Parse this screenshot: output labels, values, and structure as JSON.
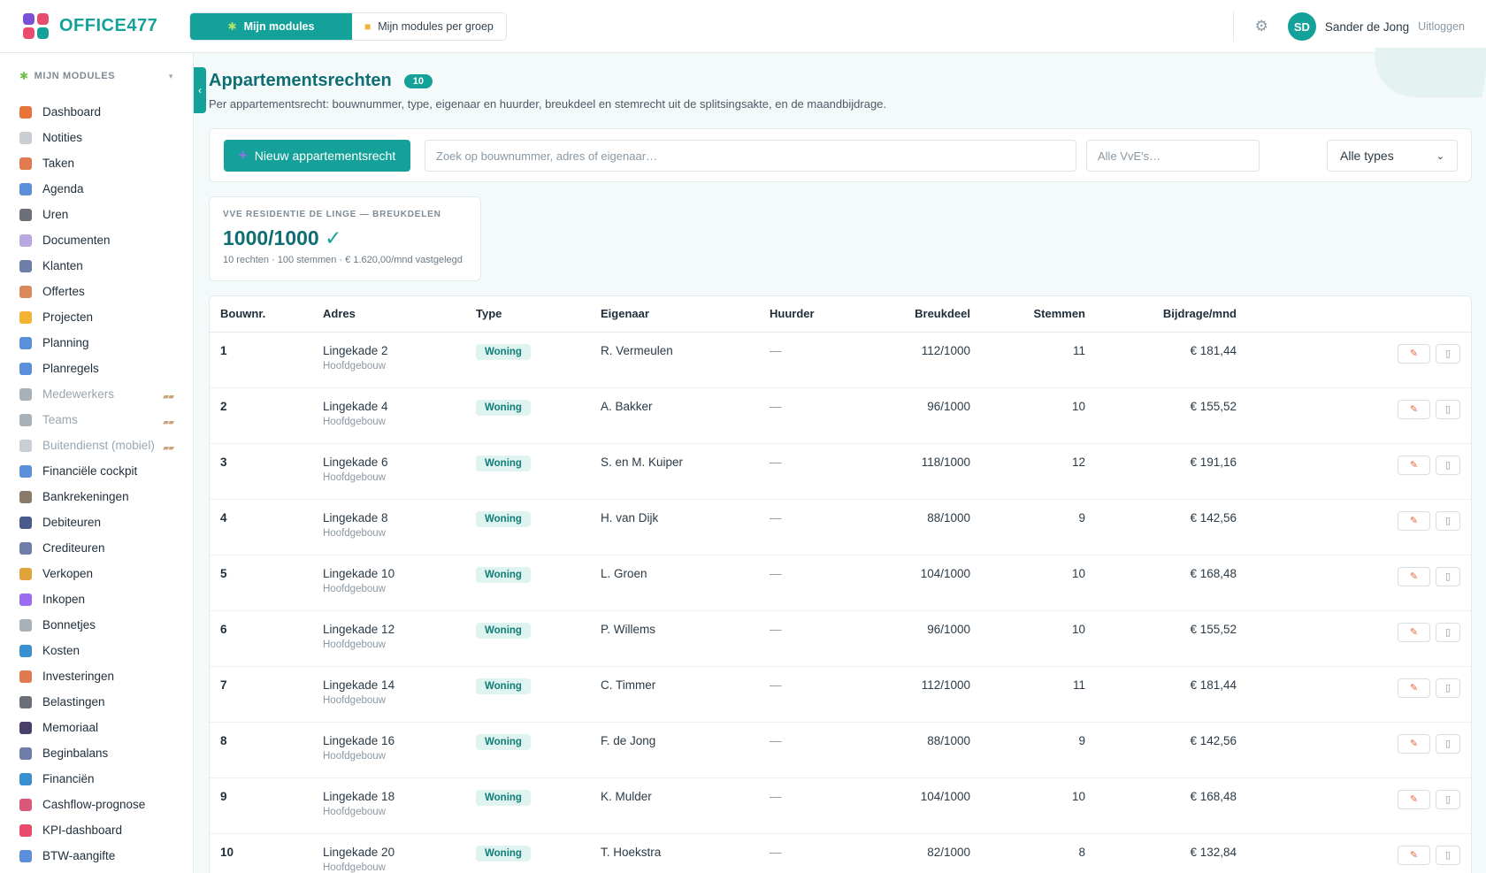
{
  "header": {
    "brand": "OFFICE477",
    "brand_colors": [
      "#7b4fd6",
      "#e84b6c",
      "#f2b233",
      "#13a19a"
    ],
    "tabs": [
      {
        "label": "Mijn modules",
        "icon": "puzzle-icon",
        "active": true
      },
      {
        "label": "Mijn modules per groep",
        "icon": "folder-icon",
        "active": false
      }
    ],
    "avatar_initials": "SD",
    "user_name": "Sander de Jong",
    "logout_label": "Uitloggen"
  },
  "sidebar": {
    "heading": "MIJN MODULES",
    "items": [
      {
        "label": "Dashboard",
        "icon": "house-icon",
        "color": "#e8743b",
        "locked": false
      },
      {
        "label": "Notities",
        "icon": "note-icon",
        "color": "#c9ced4",
        "locked": false
      },
      {
        "label": "Taken",
        "icon": "clipboard-icon",
        "color": "#e07a4f",
        "locked": false
      },
      {
        "label": "Agenda",
        "icon": "calendar-icon",
        "color": "#5b8fd9",
        "locked": false
      },
      {
        "label": "Uren",
        "icon": "clock-icon",
        "color": "#6b6f78",
        "locked": false
      },
      {
        "label": "Documenten",
        "icon": "document-icon",
        "color": "#b9a7e0",
        "locked": false
      },
      {
        "label": "Klanten",
        "icon": "building-icon",
        "color": "#6f7ea8",
        "locked": false
      },
      {
        "label": "Offertes",
        "icon": "quote-icon",
        "color": "#d9895a",
        "locked": false
      },
      {
        "label": "Projecten",
        "icon": "folder-icon",
        "color": "#f2b233",
        "locked": false
      },
      {
        "label": "Planning",
        "icon": "calendar-grid-icon",
        "color": "#5b8fd9",
        "locked": false
      },
      {
        "label": "Planregels",
        "icon": "calendar-rules-icon",
        "color": "#5b8fd9",
        "locked": false
      },
      {
        "label": "Medewerkers",
        "icon": "user-icon",
        "color": "#a8b0b8",
        "locked": true
      },
      {
        "label": "Teams",
        "icon": "users-icon",
        "color": "#a8b0b8",
        "locked": true
      },
      {
        "label": "Buitendienst (mobiel)",
        "icon": "mobile-icon",
        "color": "#c9ced4",
        "locked": true
      },
      {
        "label": "Financiële cockpit",
        "icon": "cockpit-icon",
        "color": "#5b8fd9",
        "locked": false
      },
      {
        "label": "Bankrekeningen",
        "icon": "bank-icon",
        "color": "#8a7a6a",
        "locked": false
      },
      {
        "label": "Debiteuren",
        "icon": "debtors-icon",
        "color": "#4a5a8a",
        "locked": false
      },
      {
        "label": "Crediteuren",
        "icon": "creditors-icon",
        "color": "#6f7ea8",
        "locked": false
      },
      {
        "label": "Verkopen",
        "icon": "moneybag-icon",
        "color": "#e0a23a",
        "locked": false
      },
      {
        "label": "Inkopen",
        "icon": "inbox-icon",
        "color": "#9a6cf0",
        "locked": false
      },
      {
        "label": "Bonnetjes",
        "icon": "receipt-icon",
        "color": "#a8b0b8",
        "locked": false
      },
      {
        "label": "Kosten",
        "icon": "cost-icon",
        "color": "#3a8fd0",
        "locked": false
      },
      {
        "label": "Investeringen",
        "icon": "investment-icon",
        "color": "#e07a4f",
        "locked": false
      },
      {
        "label": "Belastingen",
        "icon": "tax-building-icon",
        "color": "#6b6f78",
        "locked": false
      },
      {
        "label": "Memoriaal",
        "icon": "book-icon",
        "color": "#4a3f6a",
        "locked": false
      },
      {
        "label": "Beginbalans",
        "icon": "balance-icon",
        "color": "#6f7ea8",
        "locked": false
      },
      {
        "label": "Financiën",
        "icon": "finance-icon",
        "color": "#3a8fd0",
        "locked": false
      },
      {
        "label": "Cashflow-prognose",
        "icon": "chart-icon",
        "color": "#d9587a",
        "locked": false
      },
      {
        "label": "KPI-dashboard",
        "icon": "target-icon",
        "color": "#e84b6c",
        "locked": false
      },
      {
        "label": "BTW-aangifte",
        "icon": "vat-icon",
        "color": "#5b8fd9",
        "locked": false
      }
    ]
  },
  "page": {
    "title": "Appartementsrechten",
    "count": "10",
    "subtitle": "Per appartementsrecht: bouwnummer, type, eigenaar en huurder, breukdeel en stemrecht uit de splitsingsakte, en de maandbijdrage."
  },
  "toolbar": {
    "new_button": "Nieuw appartementsrecht",
    "search_placeholder": "Zoek op bouwnummer, adres of eigenaar…",
    "vve_placeholder": "Alle VvE's…",
    "type_select": "Alle types"
  },
  "stat": {
    "label": "VVE RESIDENTIE DE LINGE — BREUKDELEN",
    "value": "1000/1000",
    "check": "✓",
    "meta": "10 rechten · 100 stemmen · € 1.620,00/mnd vastgelegd"
  },
  "table": {
    "columns": [
      "Bouwnr.",
      "Adres",
      "Type",
      "Eigenaar",
      "Huurder",
      "Breukdeel",
      "Stemmen",
      "Bijdrage/mnd"
    ],
    "rows": [
      {
        "bouwnr": "1",
        "adres": "Lingekade 2",
        "sub": "Hoofdgebouw",
        "type": "Woning",
        "eigenaar": "R. Vermeulen",
        "huurder": "—",
        "breukdeel": "112/1000",
        "stemmen": "11",
        "bijdrage": "€ 181,44"
      },
      {
        "bouwnr": "2",
        "adres": "Lingekade 4",
        "sub": "Hoofdgebouw",
        "type": "Woning",
        "eigenaar": "A. Bakker",
        "huurder": "—",
        "breukdeel": "96/1000",
        "stemmen": "10",
        "bijdrage": "€ 155,52"
      },
      {
        "bouwnr": "3",
        "adres": "Lingekade 6",
        "sub": "Hoofdgebouw",
        "type": "Woning",
        "eigenaar": "S. en M. Kuiper",
        "huurder": "—",
        "breukdeel": "118/1000",
        "stemmen": "12",
        "bijdrage": "€ 191,16"
      },
      {
        "bouwnr": "4",
        "adres": "Lingekade 8",
        "sub": "Hoofdgebouw",
        "type": "Woning",
        "eigenaar": "H. van Dijk",
        "huurder": "—",
        "breukdeel": "88/1000",
        "stemmen": "9",
        "bijdrage": "€ 142,56"
      },
      {
        "bouwnr": "5",
        "adres": "Lingekade 10",
        "sub": "Hoofdgebouw",
        "type": "Woning",
        "eigenaar": "L. Groen",
        "huurder": "—",
        "breukdeel": "104/1000",
        "stemmen": "10",
        "bijdrage": "€ 168,48"
      },
      {
        "bouwnr": "6",
        "adres": "Lingekade 12",
        "sub": "Hoofdgebouw",
        "type": "Woning",
        "eigenaar": "P. Willems",
        "huurder": "—",
        "breukdeel": "96/1000",
        "stemmen": "10",
        "bijdrage": "€ 155,52"
      },
      {
        "bouwnr": "7",
        "adres": "Lingekade 14",
        "sub": "Hoofdgebouw",
        "type": "Woning",
        "eigenaar": "C. Timmer",
        "huurder": "—",
        "breukdeel": "112/1000",
        "stemmen": "11",
        "bijdrage": "€ 181,44"
      },
      {
        "bouwnr": "8",
        "adres": "Lingekade 16",
        "sub": "Hoofdgebouw",
        "type": "Woning",
        "eigenaar": "F. de Jong",
        "huurder": "—",
        "breukdeel": "88/1000",
        "stemmen": "9",
        "bijdrage": "€ 142,56"
      },
      {
        "bouwnr": "9",
        "adres": "Lingekade 18",
        "sub": "Hoofdgebouw",
        "type": "Woning",
        "eigenaar": "K. Mulder",
        "huurder": "—",
        "breukdeel": "104/1000",
        "stemmen": "10",
        "bijdrage": "€ 168,48"
      },
      {
        "bouwnr": "10",
        "adres": "Lingekade 20",
        "sub": "Hoofdgebouw",
        "type": "Woning",
        "eigenaar": "T. Hoekstra",
        "huurder": "—",
        "breukdeel": "82/1000",
        "stemmen": "8",
        "bijdrage": "€ 132,84"
      }
    ]
  }
}
